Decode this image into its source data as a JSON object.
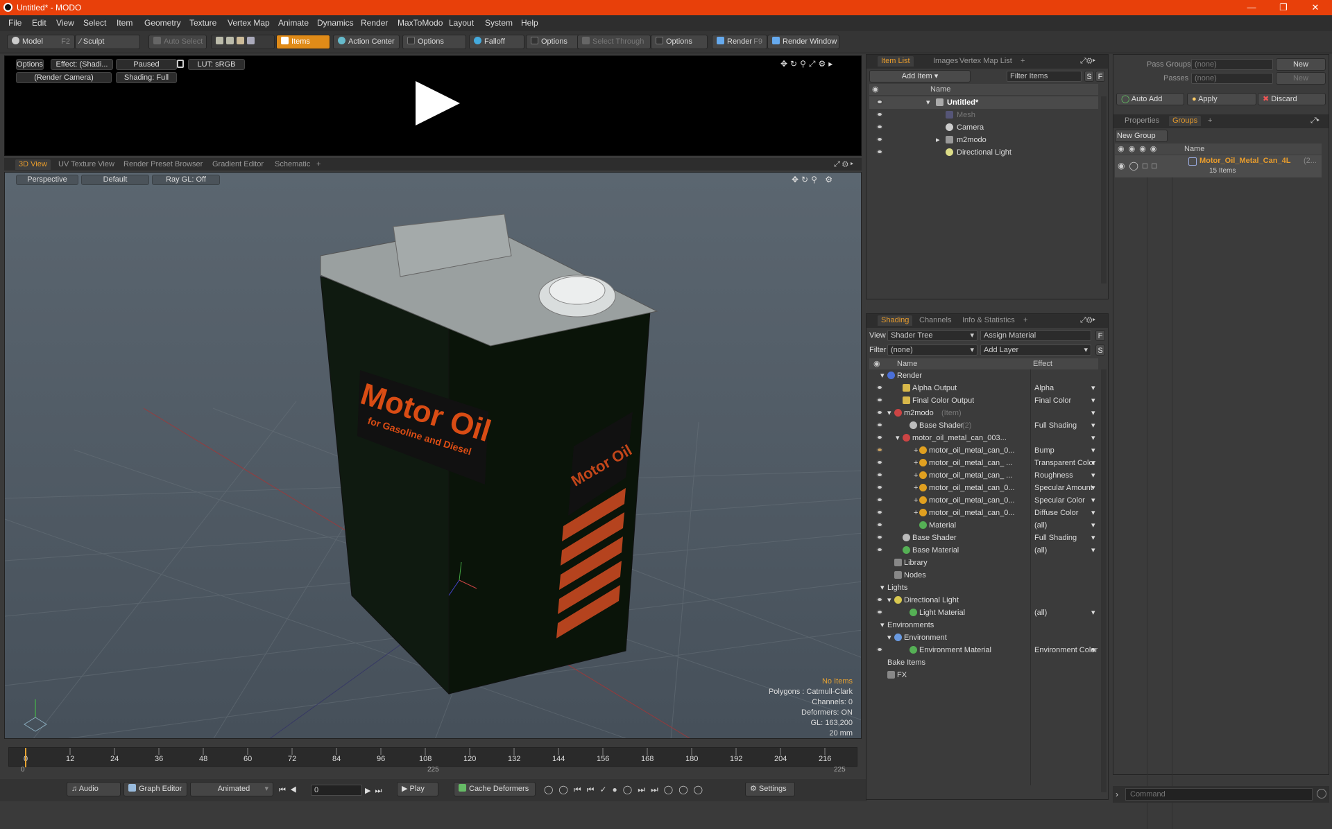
{
  "window": {
    "title": "Untitled* - MODO"
  },
  "menu": [
    "File",
    "Edit",
    "View",
    "Select",
    "Item",
    "Geometry",
    "Texture",
    "Vertex Map",
    "Animate",
    "Dynamics",
    "Render",
    "MaxToModo",
    "Layout",
    "System",
    "Help"
  ],
  "toolbar": {
    "model": "Model",
    "model_key": "F2",
    "sculpt": "Sculpt",
    "auto_select": "Auto Select",
    "items": "Items",
    "action_center": "Action Center",
    "options1": "Options",
    "falloff": "Falloff",
    "options2": "Options",
    "select_through": "Select Through",
    "options3": "Options",
    "render": "Render",
    "render_key": "F9",
    "render_window": "Render Window"
  },
  "preview": {
    "options": "Options",
    "effect": "Effect: (Shadi...",
    "paused": "Paused",
    "lut": "LUT: sRGB",
    "camera": "(Render Camera)",
    "shading": "Shading: Full"
  },
  "view_tabs": [
    "3D View",
    "UV Texture View",
    "Render Preset Browser",
    "Gradient Editor",
    "Schematic",
    "+"
  ],
  "viewport": {
    "projection": "Perspective",
    "style": "Default",
    "raygl": "Ray GL: Off",
    "stats": {
      "no_items": "No Items",
      "polygons": "Polygons : Catmull-Clark",
      "channels": "Channels: 0",
      "deformers": "Deformers: ON",
      "gl": "GL: 163,200",
      "scale": "20 mm"
    },
    "can_label_main": "Motor Oil",
    "can_label_sub": "for Gasoline and Diesel",
    "can_label_side": "Motor Oil"
  },
  "timeline": {
    "ticks": [
      "0",
      "12",
      "24",
      "36",
      "48",
      "60",
      "72",
      "84",
      "96",
      "108",
      "120",
      "132",
      "144",
      "156",
      "168",
      "180",
      "192",
      "204",
      "216"
    ],
    "start": "0",
    "mid": "225",
    "end": "225"
  },
  "transport": {
    "audio": "Audio",
    "graph_editor": "Graph Editor",
    "animated": "Animated",
    "frame": "0",
    "play": "Play",
    "cache_deformers": "Cache Deformers",
    "settings": "Settings"
  },
  "item_list": {
    "tabs": [
      "Item List",
      "Images",
      "Vertex Map List",
      "+"
    ],
    "add_item": "Add Item",
    "filter_items": "Filter Items",
    "s": "S",
    "f": "F",
    "col_name": "Name",
    "items": [
      {
        "label": "Untitled*"
      },
      {
        "label": "Mesh"
      },
      {
        "label": "Camera"
      },
      {
        "label": "m2modo"
      },
      {
        "label": "Directional Light"
      }
    ]
  },
  "shading": {
    "tabs": [
      "Shading",
      "Channels",
      "Info & Statistics",
      "+"
    ],
    "view_label": "View",
    "view_value": "Shader Tree",
    "assign_material": "Assign Material",
    "f": "F",
    "filter_label": "Filter",
    "filter_value": "(none)",
    "add_layer": "Add Layer",
    "s": "S",
    "col_name": "Name",
    "col_effect": "Effect",
    "rows": [
      {
        "name": "Render",
        "effect": ""
      },
      {
        "name": "Alpha Output",
        "effect": "Alpha"
      },
      {
        "name": "Final Color Output",
        "effect": "Final Color"
      },
      {
        "name": "m2modo",
        "effect": ""
      },
      {
        "name": "Base Shader",
        "effect": "Full Shading"
      },
      {
        "name": "motor_oil_metal_can_003...",
        "effect": ""
      },
      {
        "name": "motor_oil_metal_can_0...",
        "effect": "Bump"
      },
      {
        "name": "motor_oil_metal_can_ ...",
        "effect": "Transparent Color"
      },
      {
        "name": "motor_oil_metal_can_ ...",
        "effect": "Roughness"
      },
      {
        "name": "motor_oil_metal_can_0...",
        "effect": "Specular Amount"
      },
      {
        "name": "motor_oil_metal_can_0...",
        "effect": "Specular Color"
      },
      {
        "name": "motor_oil_metal_can_0...",
        "effect": "Diffuse Color"
      },
      {
        "name": "Material",
        "effect": "(all)"
      },
      {
        "name": "Base Shader",
        "effect": "Full Shading"
      },
      {
        "name": "Base Material",
        "effect": "(all)"
      },
      {
        "name": "Library",
        "effect": ""
      },
      {
        "name": "Nodes",
        "effect": ""
      },
      {
        "name": "Lights",
        "effect": ""
      },
      {
        "name": "Directional Light",
        "effect": ""
      },
      {
        "name": "Light Material",
        "effect": "(all)"
      },
      {
        "name": "Environments",
        "effect": ""
      },
      {
        "name": "Environment",
        "effect": ""
      },
      {
        "name": "Environment Material",
        "effect": "Environment Color"
      },
      {
        "name": "Bake Items",
        "effect": ""
      },
      {
        "name": "FX",
        "effect": ""
      }
    ],
    "suffix_item": "(Item)",
    "suffix_2": "(2)"
  },
  "groups": {
    "pass_groups": "Pass Groups",
    "passes": "Passes",
    "none1": "(none)",
    "none2": "(none)",
    "new1": "New",
    "new2": "New",
    "auto_add": "Auto Add",
    "apply": "Apply",
    "discard": "Discard",
    "tabs": [
      "Properties",
      "Groups",
      "+"
    ],
    "new_group": "New Group",
    "col_name": "Name",
    "group_name": "Motor_Oil_Metal_Can_4L",
    "group_suffix": "(2...",
    "group_count": "15 Items"
  },
  "command": {
    "placeholder": "Command"
  }
}
